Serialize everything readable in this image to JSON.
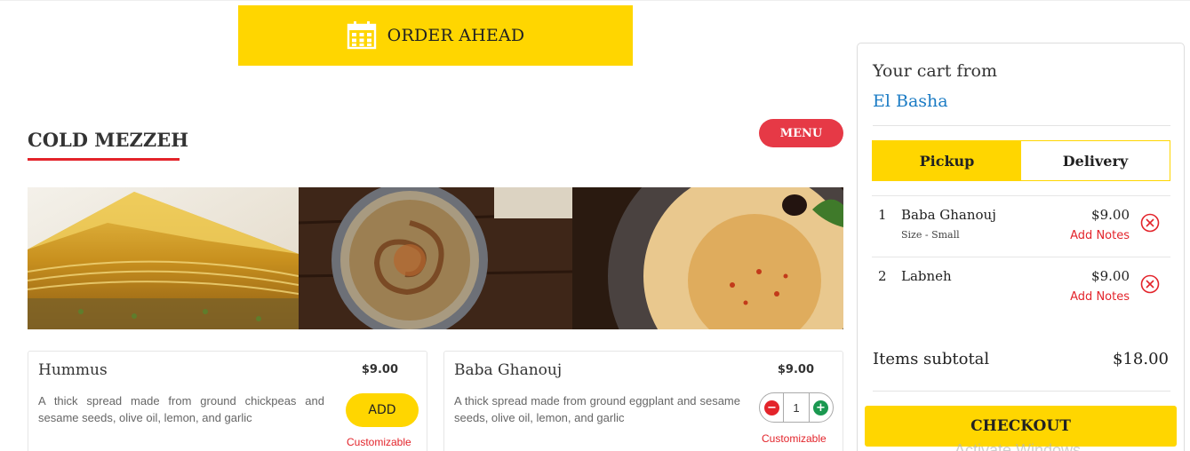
{
  "colors": {
    "accent_yellow": "#ffd600",
    "accent_red": "#e3242b",
    "link_blue": "#1a7bc4",
    "add_green": "#1a9850"
  },
  "order_ahead": {
    "label": "ORDER AHEAD",
    "icon": "calendar-icon"
  },
  "section": {
    "title": "COLD MEZZEH",
    "menu_button": "MENU"
  },
  "banner": {
    "images": [
      "baklava-image",
      "baba-ghanouj-image",
      "hummus-image"
    ]
  },
  "items": [
    {
      "name": "Hummus",
      "price": "$9.00",
      "description": "A thick spread made from ground chickpeas and sesame seeds, olive oil, lemon, and garlic",
      "button": "ADD",
      "customizable": "Customizable"
    },
    {
      "name": "Baba Ghanouj",
      "price": "$9.00",
      "description": "A thick spread made from ground eggplant and sesame seeds, olive oil, lemon, and garlic",
      "quantity": "1",
      "customizable": "Customizable"
    }
  ],
  "cart": {
    "heading": "Your cart from",
    "restaurant": "El Basha",
    "tabs": [
      "Pickup",
      "Delivery"
    ],
    "active_tab": "Pickup",
    "items": [
      {
        "index": "1",
        "name": "Baba Ghanouj",
        "size": "Size - Small",
        "price": "$9.00",
        "notes": "Add Notes"
      },
      {
        "index": "2",
        "name": "Labneh",
        "price": "$9.00",
        "notes": "Add Notes"
      }
    ],
    "subtotal_label": "Items subtotal",
    "subtotal_value": "$18.00",
    "checkout": "CHECKOUT"
  },
  "watermark": "Activate Windows"
}
